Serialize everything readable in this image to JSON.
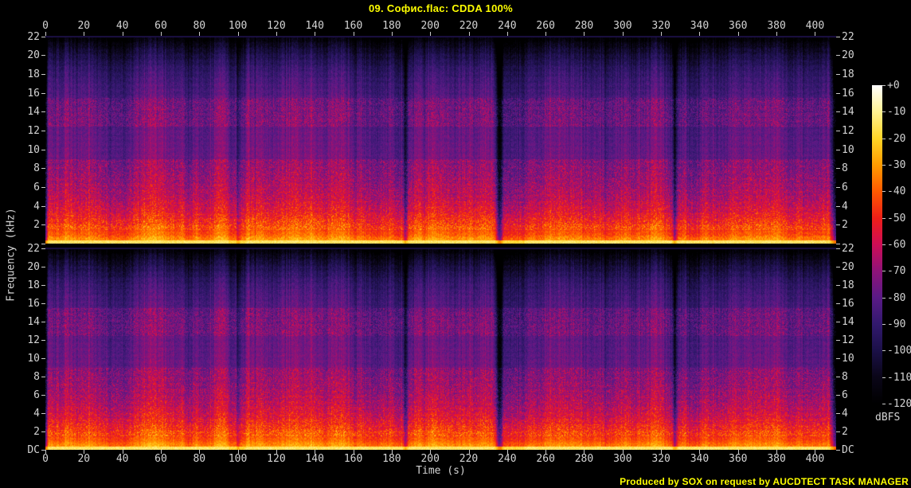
{
  "header": {
    "title": "09. Софис.flac: CDDA 100%"
  },
  "footer": {
    "credit": "Produced by SOX on request by AUCDTECT TASK MANAGER"
  },
  "axes": {
    "x_label": "Time (s)",
    "y_label": "Frequency (kHz)",
    "x_ticks": [
      0,
      20,
      40,
      60,
      80,
      100,
      120,
      140,
      160,
      180,
      200,
      220,
      240,
      260,
      280,
      300,
      320,
      340,
      360,
      380,
      400
    ],
    "y_ticks_panel1": [
      "22",
      "20",
      "18",
      "16",
      "14",
      "12",
      "10",
      "8",
      "6",
      "4",
      "2"
    ],
    "y_ticks_panel2": [
      "22",
      "20",
      "18",
      "16",
      "14",
      "12",
      "10",
      "8",
      "6",
      "4",
      "2",
      "DC"
    ]
  },
  "colorbar": {
    "unit": "dBFS",
    "tick_labels": [
      "+0",
      "-10",
      "-20",
      "-30",
      "-40",
      "-50",
      "-60",
      "-70",
      "-80",
      "-90",
      "-100",
      "-110",
      "-120"
    ]
  },
  "colors": {
    "background": "#000000",
    "title_text": "#ffff00",
    "credit_text": "#ffff00",
    "axis_text": "#d4d4d4",
    "tick_mark": "#c8c8c8"
  },
  "chart_data": {
    "type": "heatmap",
    "variant": "audio-spectrogram",
    "title": "09. Софис.flac: CDDA 100%",
    "xlabel": "Time (s)",
    "ylabel": "Frequency (kHz)",
    "panels": 2,
    "x_range_s": [
      0,
      411
    ],
    "x_tick_step_s": 20,
    "y_range_khz": [
      0,
      22.05
    ],
    "y_tick_step_khz": 2,
    "intensity_unit": "dBFS",
    "intensity_range_dbfs": [
      -120,
      0
    ],
    "legend_position": "right-colorbar",
    "grid": false,
    "colormap_stops": [
      {
        "pos": 0.0,
        "color": "#000000"
      },
      {
        "pos": 0.083,
        "color": "#0a0618"
      },
      {
        "pos": 0.167,
        "color": "#1b1048"
      },
      {
        "pos": 0.25,
        "color": "#32196e"
      },
      {
        "pos": 0.333,
        "color": "#5a1a86"
      },
      {
        "pos": 0.417,
        "color": "#8f1378"
      },
      {
        "pos": 0.5,
        "color": "#cf0d55"
      },
      {
        "pos": 0.583,
        "color": "#ee1f17"
      },
      {
        "pos": 0.667,
        "color": "#ff5a00"
      },
      {
        "pos": 0.75,
        "color": "#ff9c00"
      },
      {
        "pos": 0.833,
        "color": "#ffd527"
      },
      {
        "pos": 0.917,
        "color": "#fff293"
      },
      {
        "pos": 1.0,
        "color": "#ffffff"
      }
    ],
    "freq_profile_dbfs": [
      [
        0,
        -5
      ],
      [
        0.3,
        -10
      ],
      [
        0.8,
        -17
      ],
      [
        1.5,
        -25
      ],
      [
        2.5,
        -33
      ],
      [
        3.5,
        -40
      ],
      [
        5,
        -47
      ],
      [
        7,
        -52
      ],
      [
        9,
        -55
      ],
      [
        12,
        -57
      ],
      [
        15,
        -59
      ],
      [
        17,
        -63
      ],
      [
        18.5,
        -68
      ],
      [
        20,
        -77
      ],
      [
        21,
        -85
      ],
      [
        22.05,
        -97
      ]
    ],
    "quiet_times_s": [
      100,
      187,
      236,
      327
    ],
    "quiet_spans_s": [
      [
        95,
        104
      ],
      [
        237,
        249
      ]
    ],
    "fade_in_until_s": 1.5,
    "fade_out_from_s": 407,
    "bright_band_khz": [
      0,
      2
    ],
    "speckle_band_khz": [
      1.5,
      9
    ]
  }
}
